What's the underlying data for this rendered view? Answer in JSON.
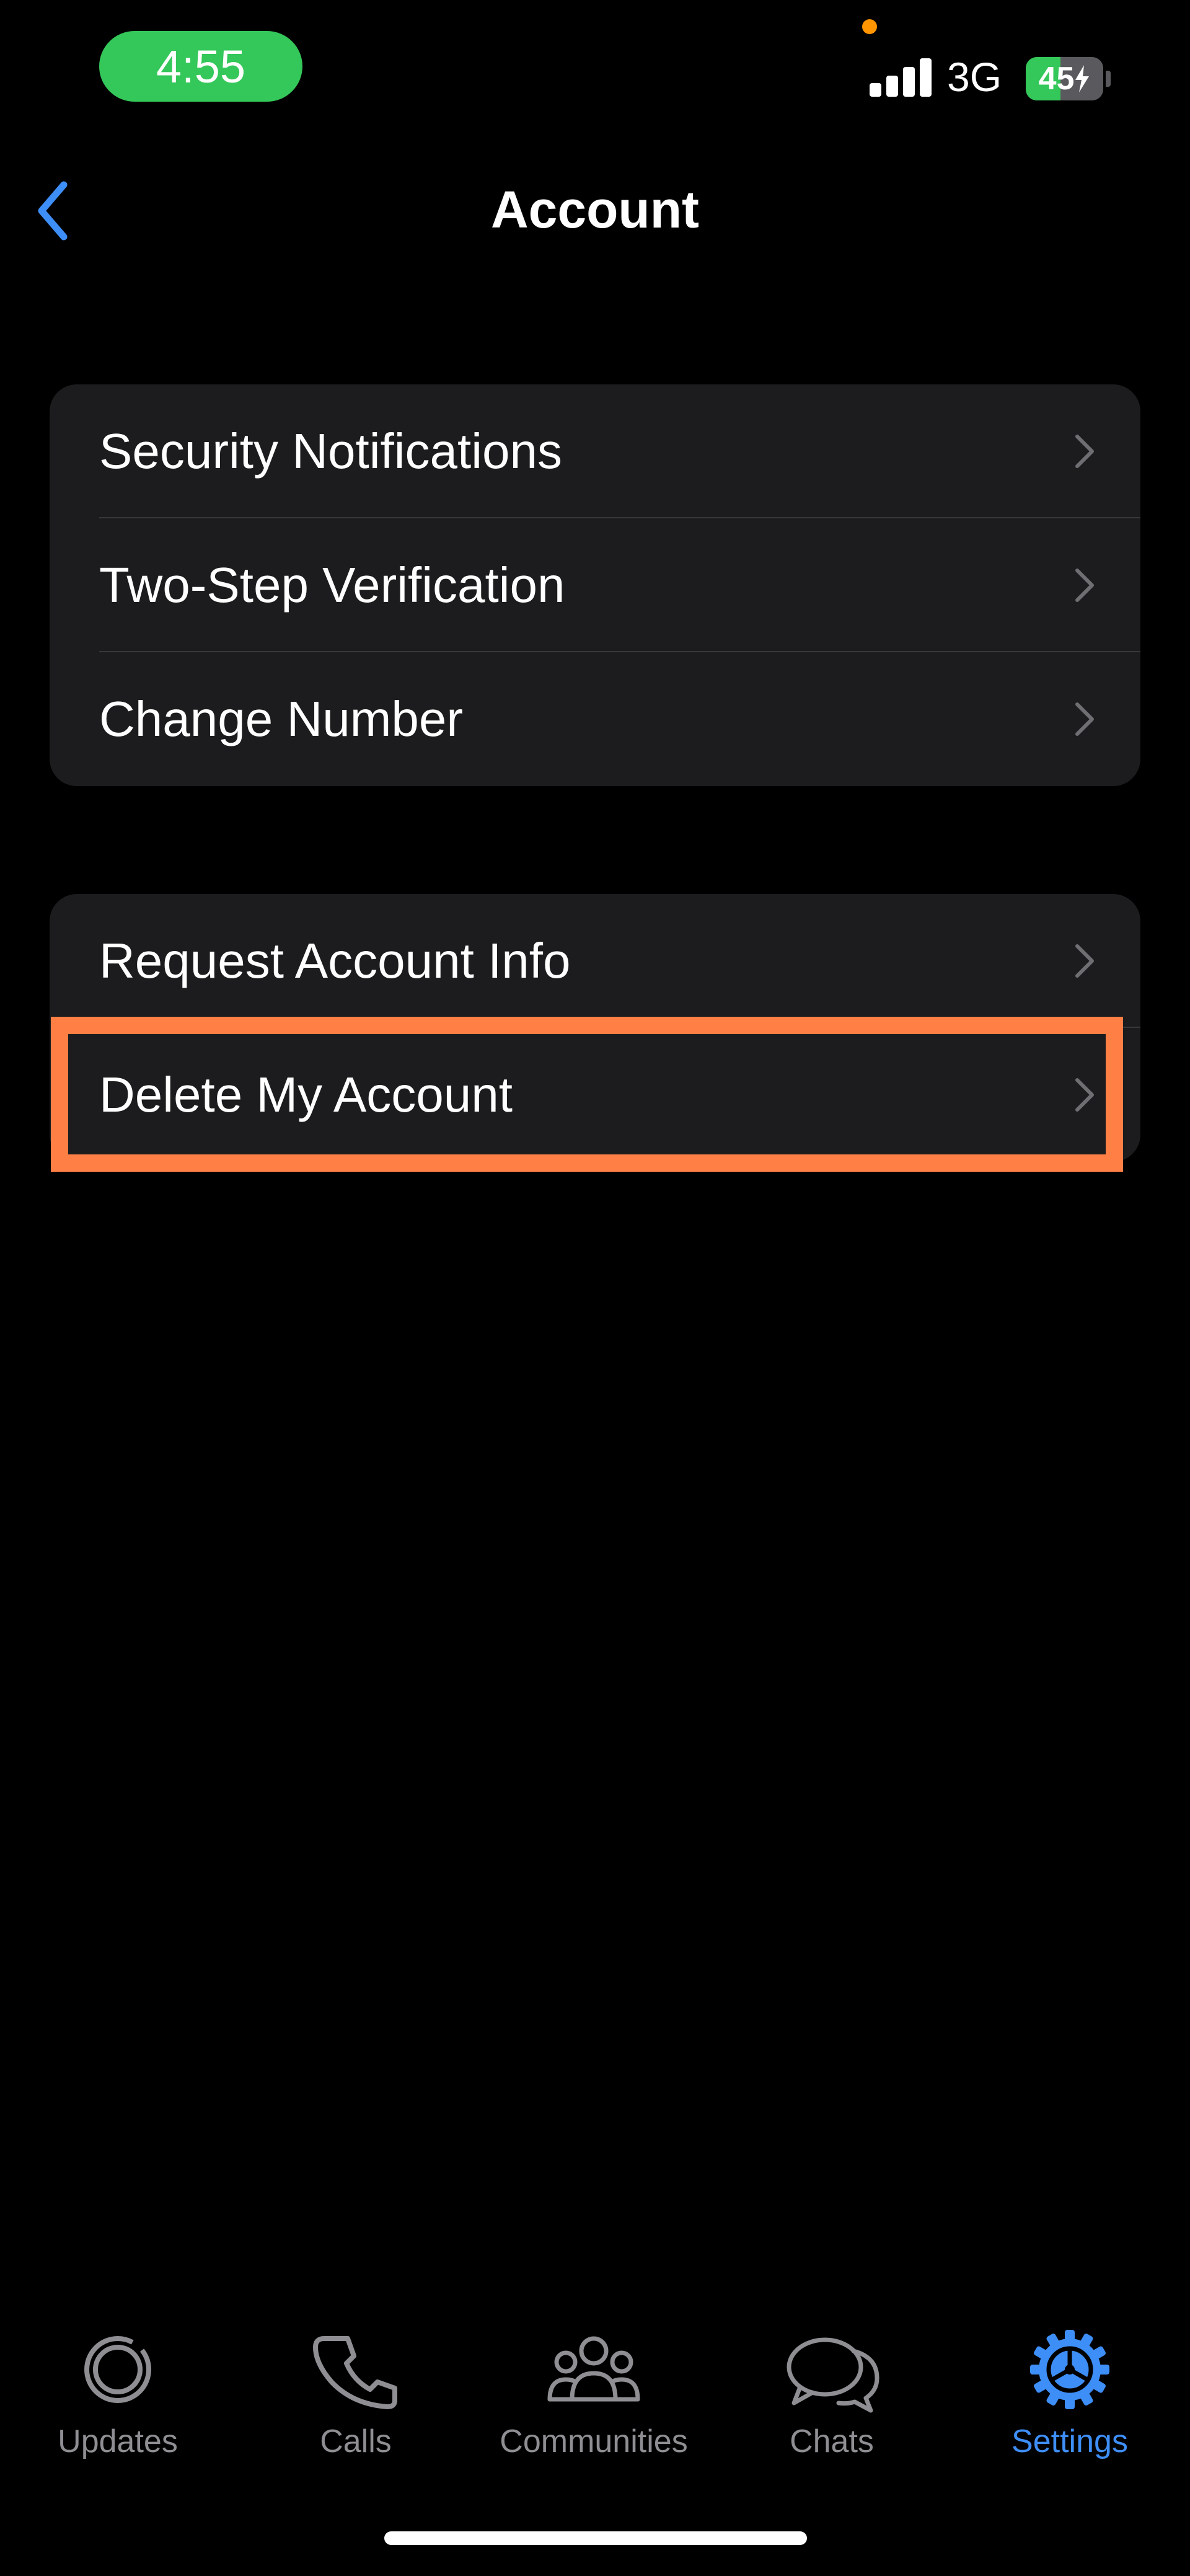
{
  "status_bar": {
    "time": "4:55",
    "network": "3G",
    "battery": "45",
    "battery_level_percent": 45
  },
  "nav": {
    "title": "Account",
    "back_icon": "chevron-left-icon"
  },
  "groups": [
    {
      "items": [
        {
          "label": "Security Notifications"
        },
        {
          "label": "Two-Step Verification"
        },
        {
          "label": "Change Number"
        }
      ]
    },
    {
      "items": [
        {
          "label": "Request Account Info"
        },
        {
          "label": "Delete My Account"
        }
      ]
    }
  ],
  "tab_bar": {
    "tabs": [
      {
        "label": "Updates",
        "icon": "updates-icon",
        "active": false
      },
      {
        "label": "Calls",
        "icon": "phone-icon",
        "active": false
      },
      {
        "label": "Communities",
        "icon": "communities-icon",
        "active": false
      },
      {
        "label": "Chats",
        "icon": "chats-icon",
        "active": false
      },
      {
        "label": "Settings",
        "icon": "gear-icon",
        "active": true
      }
    ]
  },
  "colors": {
    "background": "#000000",
    "group_background": "#1c1c1e",
    "accent": "#3e8ef7",
    "time_pill": "#34c759",
    "highlight": "#ff7f45",
    "inactive_tab": "#8e8e93"
  }
}
